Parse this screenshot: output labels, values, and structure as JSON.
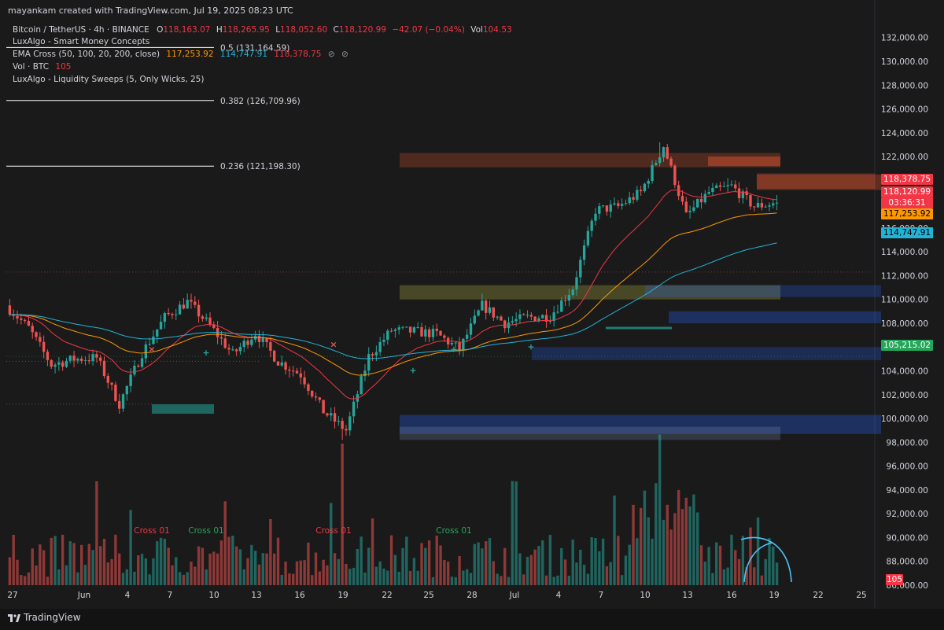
{
  "header": {
    "attribution": "mayankam created with TradingView.com, Jul 19, 2025 08:23 UTC",
    "symbol": "Bitcoin / TetherUS · 4h · BINANCE",
    "o_label": "O",
    "o_value": "118,163.07",
    "h_label": "H",
    "h_value": "118,265.95",
    "l_label": "L",
    "l_value": "118,052.60",
    "c_label": "C",
    "c_value": "118,120.99",
    "change": "−42.07 (−0.04%)",
    "vol_label": "Vol",
    "vol_value": "104.53"
  },
  "indicators": {
    "smc": "LuxAlgo - Smart Money Concepts",
    "ema_label": "EMA Cross (50, 100, 20, 200, close)",
    "ema_v1": "117,253.92",
    "ema_v2": "114,747.91",
    "ema_v3": "118,378.75",
    "vol_label": "Vol · BTC",
    "vol_value": "105",
    "sweeps": "LuxAlgo - Liquidity Sweeps (5, Only Wicks, 25)"
  },
  "fib_levels": [
    {
      "label": "0.5 (131,164.59)",
      "value": 131164.59
    },
    {
      "label": "0.382 (126,709.96)",
      "value": 126709.96
    },
    {
      "label": "0.236 (121,198.30)",
      "value": 121198.3
    }
  ],
  "price_axis": {
    "ticks": [
      "132,000.00",
      "130,000.00",
      "128,000.00",
      "126,000.00",
      "124,000.00",
      "122,000.00",
      "120,000.00",
      "118,000.00",
      "116,000.00",
      "114,000.00",
      "112,000.00",
      "110,000.00",
      "108,000.00",
      "106,000.00",
      "104,000.00",
      "102,000.00",
      "100,000.00",
      "98,000.00",
      "96,000.00",
      "94,000.00",
      "92,000.00",
      "90,000.00",
      "88,000.00",
      "86,000.00"
    ],
    "tick_values": [
      132000,
      130000,
      128000,
      126000,
      124000,
      122000,
      120000,
      118000,
      116000,
      114000,
      112000,
      110000,
      108000,
      106000,
      104000,
      102000,
      100000,
      98000,
      96000,
      94000,
      92000,
      90000,
      88000,
      86000
    ]
  },
  "price_tags": [
    {
      "text": "118,378.75",
      "value": 118378.75,
      "color": "#f23645"
    },
    {
      "text": "118,120.99",
      "value": 118120.99,
      "color": "#f23645"
    },
    {
      "text": "03:36:31",
      "value": 117260,
      "color": "#f23645"
    },
    {
      "text": "117,253.92",
      "value": 117253.92,
      "color": "#ff9800"
    },
    {
      "text": "114,747.91",
      "value": 114747.91,
      "color": "#22b3d6"
    },
    {
      "text": "105,215.02",
      "value": 105215.02,
      "color": "#26a65b"
    }
  ],
  "volume_tag": {
    "text": "105",
    "color": "#f23645"
  },
  "time_axis": {
    "labels": [
      "27",
      "Jun",
      "4",
      "7",
      "10",
      "13",
      "16",
      "19",
      "22",
      "25",
      "28",
      "Jul",
      "4",
      "7",
      "10",
      "13",
      "16",
      "19",
      "22",
      "25"
    ],
    "label_x": [
      16,
      107,
      162,
      216,
      272,
      326,
      381,
      436,
      492,
      545,
      600,
      654,
      710,
      764,
      820,
      874,
      930,
      984,
      1040,
      1095
    ]
  },
  "cross_labels": [
    {
      "text": "Cross 01",
      "color": "#f23645",
      "x": 193
    },
    {
      "text": "Cross 01",
      "color": "#26a65b",
      "x": 262
    },
    {
      "text": "Cross 01",
      "color": "#f23645",
      "x": 424
    },
    {
      "text": "Cross 01",
      "color": "#26a65b",
      "x": 577
    }
  ],
  "branding": {
    "name": "TradingView"
  },
  "colors": {
    "background": "#1a1a1a",
    "up": "#26a69a",
    "down": "#ef5350",
    "ema20": "#f23645",
    "ema50": "#ff9800",
    "ema100": "#22b3d6"
  },
  "chart_data": {
    "type": "candlestick",
    "symbol": "BTCUSDT",
    "timeframe": "4h",
    "ylim": [
      86000,
      133500
    ],
    "start_date": "2025-05-27",
    "end_date": "2025-07-19",
    "approx_daily_closes": [
      {
        "date": "May 27",
        "close": 109500
      },
      {
        "date": "May 29",
        "close": 107600
      },
      {
        "date": "May 31",
        "close": 104500
      },
      {
        "date": "Jun 2",
        "close": 105000
      },
      {
        "date": "Jun 4",
        "close": 105100
      },
      {
        "date": "Jun 5",
        "close": 101200
      },
      {
        "date": "Jun 7",
        "close": 105500
      },
      {
        "date": "Jun 9",
        "close": 108500
      },
      {
        "date": "Jun 10",
        "close": 109800
      },
      {
        "date": "Jun 12",
        "close": 107800
      },
      {
        "date": "Jun 14",
        "close": 105400
      },
      {
        "date": "Jun 16",
        "close": 107200
      },
      {
        "date": "Jun 18",
        "close": 104800
      },
      {
        "date": "Jun 20",
        "close": 103700
      },
      {
        "date": "Jun 22",
        "close": 100600
      },
      {
        "date": "Jun 23",
        "close": 99000
      },
      {
        "date": "Jun 24",
        "close": 105200
      },
      {
        "date": "Jun 26",
        "close": 107400
      },
      {
        "date": "Jun 28",
        "close": 107300
      },
      {
        "date": "Jun 30",
        "close": 107100
      },
      {
        "date": "Jul 2",
        "close": 105800
      },
      {
        "date": "Jul 3",
        "close": 109500
      },
      {
        "date": "Jul 5",
        "close": 108000
      },
      {
        "date": "Jul 7",
        "close": 108500
      },
      {
        "date": "Jul 9",
        "close": 108600
      },
      {
        "date": "Jul 10",
        "close": 111000
      },
      {
        "date": "Jul 11",
        "close": 117500
      },
      {
        "date": "Jul 12",
        "close": 117800
      },
      {
        "date": "Jul 13",
        "close": 119000
      },
      {
        "date": "Jul 14",
        "close": 122900
      },
      {
        "date": "Jul 15",
        "close": 117000
      },
      {
        "date": "Jul 16",
        "close": 119000
      },
      {
        "date": "Jul 17",
        "close": 119500
      },
      {
        "date": "Jul 18",
        "close": 117800
      },
      {
        "date": "Jul 19",
        "close": 118120.99
      }
    ],
    "ema_last": {
      "ema20": 118378.75,
      "ema50": 117253.92,
      "ema100": 114747.91
    },
    "last_close": 118120.99,
    "volume_last": 105,
    "zones": [
      {
        "type": "supply",
        "color": "#e4572e",
        "top": 122300,
        "bottom": 121100
      },
      {
        "type": "supply",
        "color": "#e4572e",
        "top": 122000,
        "bottom": 121200
      },
      {
        "type": "supply",
        "color": "#e4572e",
        "top": 120500,
        "bottom": 119200
      },
      {
        "type": "equilibrium",
        "color": "#a0a040",
        "top": 111200,
        "bottom": 110000
      },
      {
        "type": "demand",
        "color": "#2962ff",
        "top": 111200,
        "bottom": 110200
      },
      {
        "type": "demand",
        "color": "#2962ff",
        "top": 109000,
        "bottom": 108000
      },
      {
        "type": "demand",
        "color": "#2962ff",
        "top": 106000,
        "bottom": 104900
      },
      {
        "type": "demand",
        "color": "#2962ff",
        "top": 100300,
        "bottom": 98700
      },
      {
        "type": "demand",
        "color": "#26a69a",
        "top": 101200,
        "bottom": 100400
      }
    ]
  }
}
